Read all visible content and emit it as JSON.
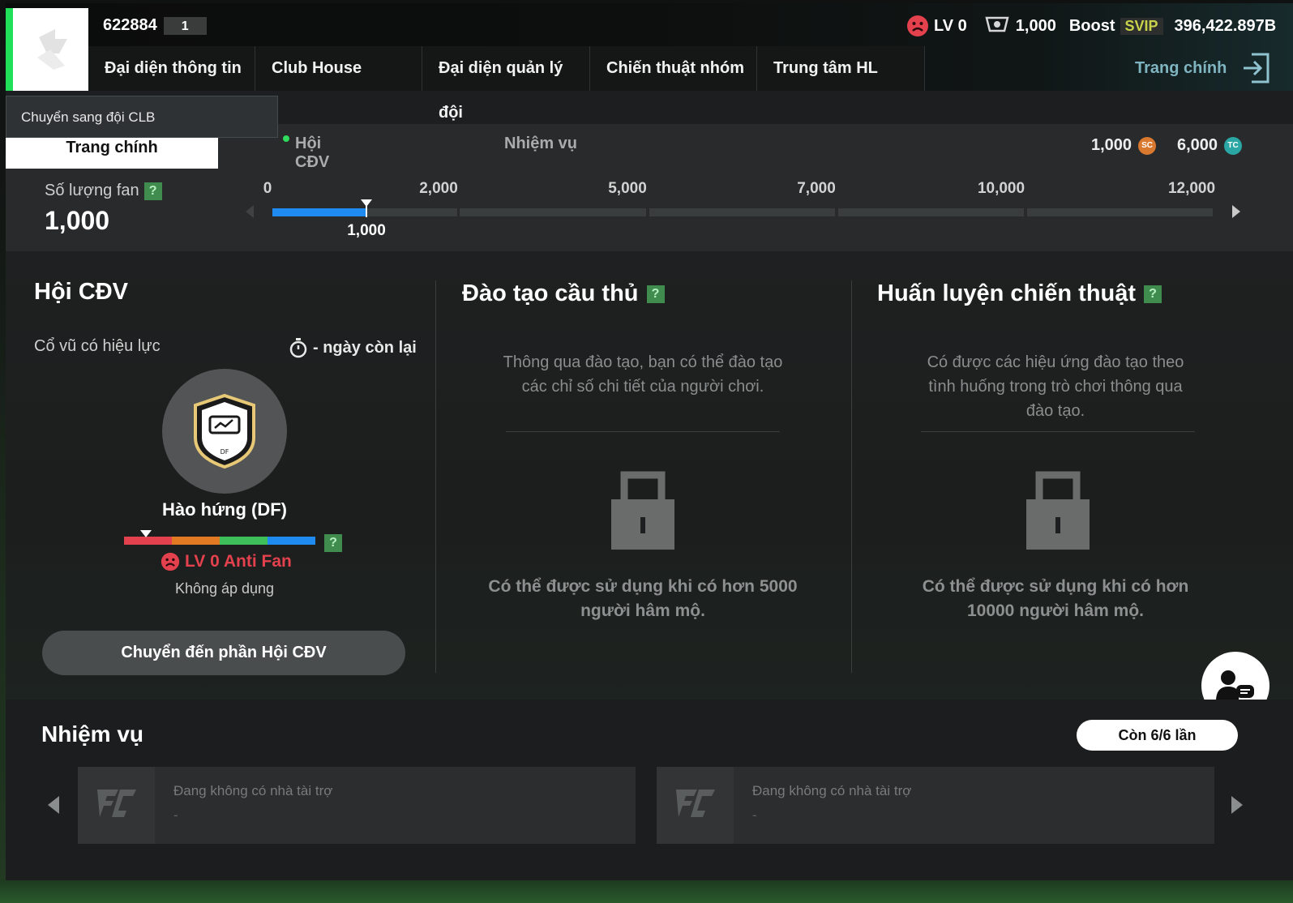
{
  "header": {
    "club_id": "622884",
    "club_num": "1",
    "level": "LV 0",
    "trophies": "1,000",
    "boost_label": "Boost",
    "svip_label": "SVIP",
    "balance": "396,422.897B",
    "home_label": "Trang chính"
  },
  "nav": {
    "items": [
      {
        "label": "Đại diện thông tin đội"
      },
      {
        "label": "Club House"
      },
      {
        "label": "Đại diện quản lý đội"
      },
      {
        "label": "Chiến thuật nhóm"
      },
      {
        "label": "Trung tâm HL"
      }
    ]
  },
  "dropdown": {
    "label": "Chuyển sang đội CLB"
  },
  "subnav": {
    "active": "Trang chính",
    "tabs": [
      "Hội CĐV",
      "Nhiệm vụ"
    ]
  },
  "currency": {
    "sc_value": "1,000",
    "sc_icon": "SC",
    "tc_value": "6,000",
    "tc_icon": "TC"
  },
  "fans": {
    "label": "Số lượng fan",
    "help": "?",
    "value": "1,000",
    "ticks": [
      "0",
      "2,000",
      "5,000",
      "7,000",
      "10,000",
      "12,000"
    ],
    "current_label": "1,000",
    "progress_value": 1000
  },
  "fan_club": {
    "title": "Hội CĐV",
    "effect_label": "Cổ vũ có hiệu lực",
    "days_left": "- ngày còn lại",
    "badge_text": "DF",
    "mood_name": "Hào hứng (DF)",
    "mood_help": "?",
    "level_label": "LV 0 Anti Fan",
    "not_applicable": "Không áp dụng",
    "goto_button": "Chuyển đến phần Hội CĐV"
  },
  "training": {
    "title": "Đào tạo cầu thủ",
    "help": "?",
    "desc_line1": "Thông qua đào tạo, bạn có thể đào tạo",
    "desc_line2": "các chỉ số chi tiết của người chơi.",
    "unlock_line1": "Có thể được sử dụng khi có hơn 5000",
    "unlock_line2": "người hâm mộ."
  },
  "tactics": {
    "title": "Huấn luyện chiến thuật",
    "help": "?",
    "desc_line1": "Có được các hiệu ứng đào tạo theo",
    "desc_line2": "tình huống trong trò chơi thông qua",
    "desc_line3": "đào tạo.",
    "unlock_line1": "Có thể được sử dụng khi có hơn",
    "unlock_line2": "10000 người hâm mộ."
  },
  "missions": {
    "title": "Nhiệm vụ",
    "remaining": "Còn 6/6 lần",
    "cards": [
      {
        "text": "Đang không có nhà tài trợ",
        "sub": "-"
      },
      {
        "text": "Đang không có nhà tài trợ",
        "sub": "-"
      }
    ]
  },
  "colors": {
    "accent_green": "#20e05a",
    "progress_blue": "#1f8bf0",
    "anti_fan_red": "#e3414d"
  }
}
